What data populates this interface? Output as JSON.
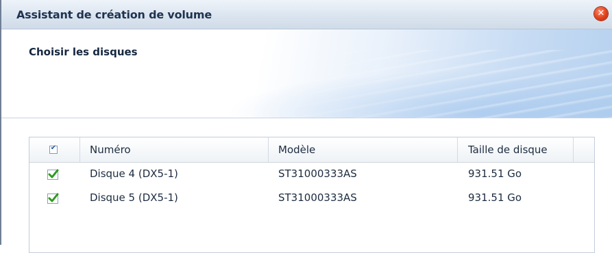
{
  "window": {
    "title": "Assistant de création de volume"
  },
  "step": {
    "title": "Choisir les disques"
  },
  "grid": {
    "columns": [
      "Numéro",
      "Modèle",
      "Taille de disque"
    ],
    "rows": [
      {
        "checked": true,
        "number": "Disque 4 (DX5-1)",
        "model": "ST31000333AS",
        "size": "931.51 Go"
      },
      {
        "checked": true,
        "number": "Disque 5 (DX5-1)",
        "model": "ST31000333AS",
        "size": "931.51 Go"
      }
    ]
  },
  "colors": {
    "accent": "#2f9a1f",
    "title_text": "#1f3350",
    "close": "#e0401c"
  },
  "icons": {
    "close": "close-icon",
    "check": "checkmark-icon"
  }
}
